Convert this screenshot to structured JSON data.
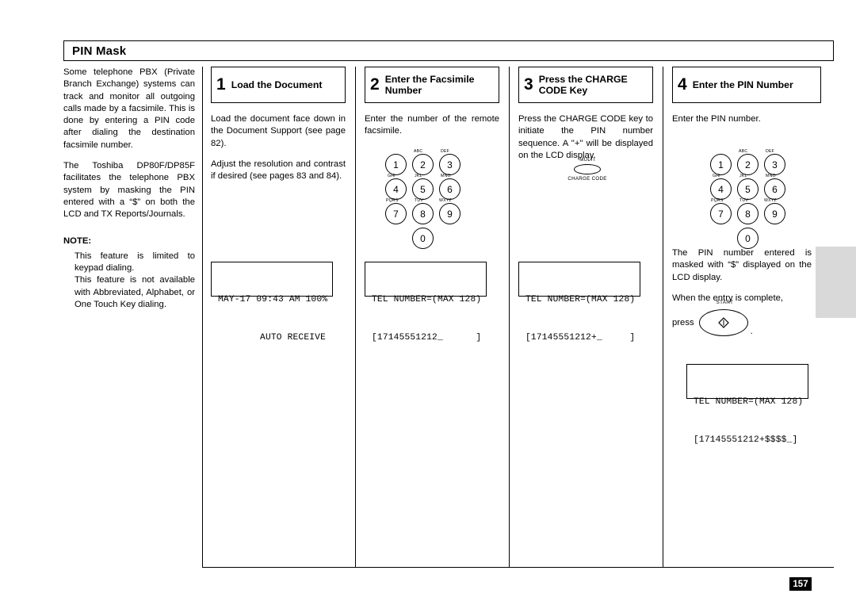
{
  "page": {
    "title": "PIN Mask",
    "number": "157"
  },
  "intro": {
    "paragraphs": [
      "Some telephone PBX (Private Branch Exchange) systems can track and monitor all outgoing calls made by a facsimile. This is done by entering a PIN code after dialing the destination facsimile number.",
      "The Toshiba DP80F/DP85F facilitates the telephone PBX system by masking the PIN entered with a “$” on both the LCD and TX Reports/Journals."
    ],
    "note_heading": "NOTE:",
    "notes": [
      "This feature is limited to keypad dialing.",
      "This feature is not available with Abbreviated, Alphabet, or One Touch Key dialing."
    ]
  },
  "steps": [
    {
      "number": "1",
      "title": "Load the Document",
      "paragraphs": [
        "Load the document face down in the Document Support (see page 82).",
        "Adjust the resolution and contrast if desired (see pages 83 and 84)."
      ],
      "lcd": {
        "line1": "MAY-17 09:43 AM 100%",
        "line2": "AUTO RECEIVE"
      }
    },
    {
      "number": "2",
      "title": "Enter the Facsimile Number",
      "paragraphs": [
        "Enter the number of the remote facsimile."
      ],
      "lcd": {
        "line1": "TEL NUMBER=(MAX 128)",
        "line2": "[17145551212_      ]"
      }
    },
    {
      "number": "3",
      "title": "Press the CHARGE CODE Key",
      "paragraphs": [
        "Press the CHARGE CODE key to initiate the PIN number sequence. A \"+\" will be displayed on the LCD display."
      ],
      "button": {
        "top_label": "MULTI",
        "bottom_label": "CHARGE CODE"
      },
      "lcd": {
        "line1": "TEL NUMBER=(MAX 128)",
        "line2": "[17145551212+_     ]"
      }
    },
    {
      "number": "4",
      "title": "Enter the PIN Number",
      "paragraphs": [
        "Enter the PIN number.",
        "The PIN number entered is masked with “$” displayed on the LCD display.",
        "When the entry is complete,"
      ],
      "press_label": "press",
      "press_period": ".",
      "start_label": "START",
      "lcd": {
        "line1": "TEL NUMBER=(MAX 128)",
        "line2": "[17145551212+$$$$_]"
      }
    }
  ],
  "keypad": {
    "keys": [
      {
        "digit": "1",
        "letters": ""
      },
      {
        "digit": "2",
        "letters": "ABC"
      },
      {
        "digit": "3",
        "letters": "DEF"
      },
      {
        "digit": "4",
        "letters": "GHI"
      },
      {
        "digit": "5",
        "letters": "JKL"
      },
      {
        "digit": "6",
        "letters": "MNO"
      },
      {
        "digit": "7",
        "letters": "PQRS"
      },
      {
        "digit": "8",
        "letters": "TUV"
      },
      {
        "digit": "9",
        "letters": "WXYZ"
      },
      {
        "digit": "0",
        "letters": ""
      }
    ]
  }
}
